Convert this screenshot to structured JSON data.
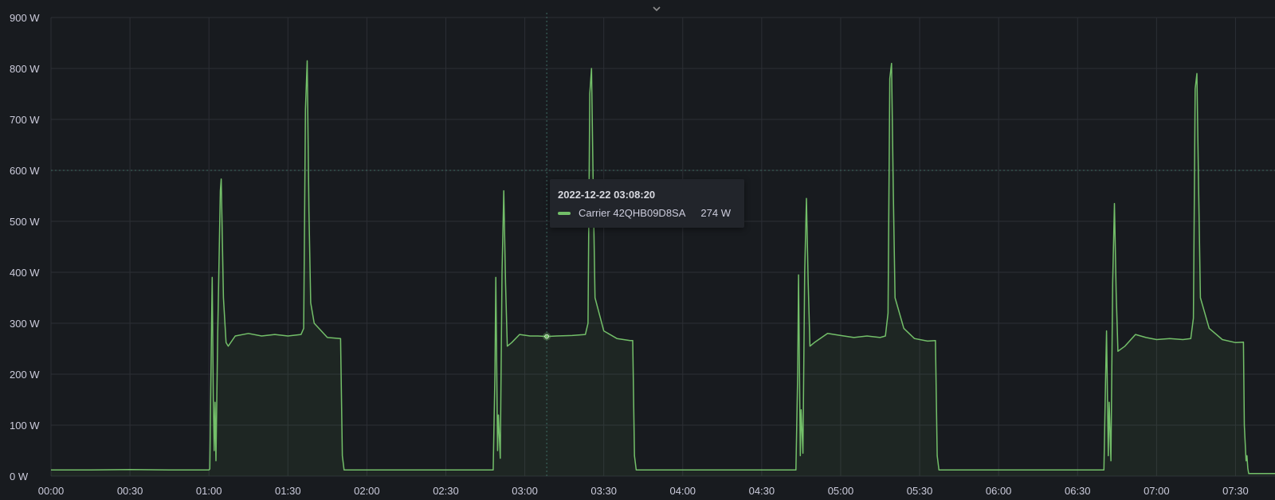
{
  "colors": {
    "background": "#181b1f",
    "grid": "#2c2f35",
    "series": "#73bf69",
    "threshold": "#3f6b63",
    "text": "#ccccdc"
  },
  "icons": {
    "collapse": "chevron-down-icon"
  },
  "tooltip": {
    "time": "2022-12-22 03:08:20",
    "series_name": "Carrier 42QHB09D8SA",
    "value": "274 W"
  },
  "chart_data": {
    "type": "area",
    "xlim": [
      "00:00",
      "07:45"
    ],
    "ylim": [
      0,
      900
    ],
    "yticks": [
      0,
      100,
      200,
      300,
      400,
      500,
      600,
      700,
      800,
      900
    ],
    "ytick_labels": [
      "0 W",
      "100 W",
      "200 W",
      "300 W",
      "400 W",
      "500 W",
      "600 W",
      "700 W",
      "800 W",
      "900 W"
    ],
    "xticks": [
      "00:00",
      "00:30",
      "01:00",
      "01:30",
      "02:00",
      "02:30",
      "03:00",
      "03:30",
      "04:00",
      "04:30",
      "05:00",
      "05:30",
      "06:00",
      "06:30",
      "07:00",
      "07:30"
    ],
    "unit": "W",
    "grid": true,
    "threshold_line": 600,
    "crosshair_time": "03:08:20",
    "hover_point": {
      "x": "03:08:20",
      "y": 274
    },
    "series": [
      {
        "name": "Carrier 42QHB09D8SA",
        "points": [
          [
            "00:00",
            12
          ],
          [
            "00:15",
            12
          ],
          [
            "00:30",
            13
          ],
          [
            "00:45",
            12
          ],
          [
            "01:00",
            12
          ],
          [
            "01:00:20",
            14
          ],
          [
            "01:01:00",
            300
          ],
          [
            "01:01:15",
            390
          ],
          [
            "01:01:40",
            150
          ],
          [
            "01:02:00",
            50
          ],
          [
            "01:02:20",
            145
          ],
          [
            "01:02:40",
            30
          ],
          [
            "01:03:20",
            280
          ],
          [
            "01:04:20",
            560
          ],
          [
            "01:04:40",
            583
          ],
          [
            "01:05:30",
            350
          ],
          [
            "01:06:30",
            262
          ],
          [
            "01:07:20",
            255
          ],
          [
            "01:10:00",
            275
          ],
          [
            "01:15:00",
            280
          ],
          [
            "01:20:00",
            275
          ],
          [
            "01:25:00",
            278
          ],
          [
            "01:30:00",
            275
          ],
          [
            "01:35:00",
            278
          ],
          [
            "01:36:00",
            290
          ],
          [
            "01:36:40",
            720
          ],
          [
            "01:37:20",
            815
          ],
          [
            "01:38:00",
            520
          ],
          [
            "01:38:40",
            340
          ],
          [
            "01:40:00",
            300
          ],
          [
            "01:45:00",
            272
          ],
          [
            "01:50:00",
            270
          ],
          [
            "01:50:40",
            40
          ],
          [
            "01:51:20",
            12
          ],
          [
            "02:00",
            12
          ],
          [
            "02:30",
            12
          ],
          [
            "02:45",
            12
          ],
          [
            "02:48:00",
            12
          ],
          [
            "02:48:40",
            200
          ],
          [
            "02:49:00",
            390
          ],
          [
            "02:49:40",
            50
          ],
          [
            "02:50:00",
            120
          ],
          [
            "02:50:40",
            35
          ],
          [
            "02:51:20",
            400
          ],
          [
            "02:52:00",
            560
          ],
          [
            "02:52:40",
            380
          ],
          [
            "02:53:20",
            255
          ],
          [
            "02:55:00",
            262
          ],
          [
            "02:58:00",
            278
          ],
          [
            "03:02:00",
            275
          ],
          [
            "03:05:00",
            275
          ],
          [
            "03:08:20",
            274
          ],
          [
            "03:12:00",
            275
          ],
          [
            "03:18:00",
            276
          ],
          [
            "03:23:00",
            278
          ],
          [
            "03:24:00",
            300
          ],
          [
            "03:24:40",
            750
          ],
          [
            "03:25:20",
            800
          ],
          [
            "03:26:00",
            560
          ],
          [
            "03:26:40",
            350
          ],
          [
            "03:30:00",
            285
          ],
          [
            "03:35:00",
            270
          ],
          [
            "03:40:00",
            266
          ],
          [
            "03:41:00",
            266
          ],
          [
            "03:41:40",
            40
          ],
          [
            "03:42:20",
            12
          ],
          [
            "04:00",
            12
          ],
          [
            "04:30",
            12
          ],
          [
            "04:43:00",
            12
          ],
          [
            "04:43:40",
            200
          ],
          [
            "04:44:00",
            395
          ],
          [
            "04:44:40",
            40
          ],
          [
            "04:45:00",
            130
          ],
          [
            "04:45:40",
            45
          ],
          [
            "04:46:20",
            400
          ],
          [
            "04:47:00",
            545
          ],
          [
            "04:47:40",
            380
          ],
          [
            "04:48:20",
            255
          ],
          [
            "04:50:00",
            262
          ],
          [
            "04:55:00",
            280
          ],
          [
            "05:00:00",
            276
          ],
          [
            "05:05:00",
            272
          ],
          [
            "05:10:00",
            275
          ],
          [
            "05:15:00",
            272
          ],
          [
            "05:17:00",
            275
          ],
          [
            "05:18:00",
            320
          ],
          [
            "05:18:40",
            780
          ],
          [
            "05:19:20",
            810
          ],
          [
            "05:20:00",
            560
          ],
          [
            "05:20:40",
            350
          ],
          [
            "05:24:00",
            290
          ],
          [
            "05:28:00",
            270
          ],
          [
            "05:33:00",
            265
          ],
          [
            "05:36:00",
            266
          ],
          [
            "05:36:40",
            40
          ],
          [
            "05:37:20",
            12
          ],
          [
            "06:00",
            12
          ],
          [
            "06:30",
            12
          ],
          [
            "06:40:00",
            12
          ],
          [
            "06:40:40",
            200
          ],
          [
            "06:41:00",
            285
          ],
          [
            "06:41:40",
            40
          ],
          [
            "06:42:00",
            145
          ],
          [
            "06:42:40",
            30
          ],
          [
            "06:43:20",
            380
          ],
          [
            "06:44:00",
            535
          ],
          [
            "06:44:40",
            360
          ],
          [
            "06:45:20",
            245
          ],
          [
            "06:48:00",
            255
          ],
          [
            "06:52:00",
            278
          ],
          [
            "06:56:00",
            272
          ],
          [
            "07:00:00",
            268
          ],
          [
            "07:05:00",
            270
          ],
          [
            "07:10:00",
            268
          ],
          [
            "07:13:00",
            270
          ],
          [
            "07:14:00",
            310
          ],
          [
            "07:14:40",
            760
          ],
          [
            "07:15:20",
            790
          ],
          [
            "07:16:00",
            560
          ],
          [
            "07:16:40",
            350
          ],
          [
            "07:20:00",
            290
          ],
          [
            "07:25:00",
            268
          ],
          [
            "07:30:00",
            262
          ],
          [
            "07:33:00",
            263
          ],
          [
            "07:33:20",
            100
          ],
          [
            "07:34:00",
            30
          ],
          [
            "07:34:20",
            40
          ],
          [
            "07:34:40",
            15
          ],
          [
            "07:35:00",
            5
          ],
          [
            "07:40:00",
            5
          ],
          [
            "07:45:00",
            5
          ]
        ]
      }
    ]
  }
}
